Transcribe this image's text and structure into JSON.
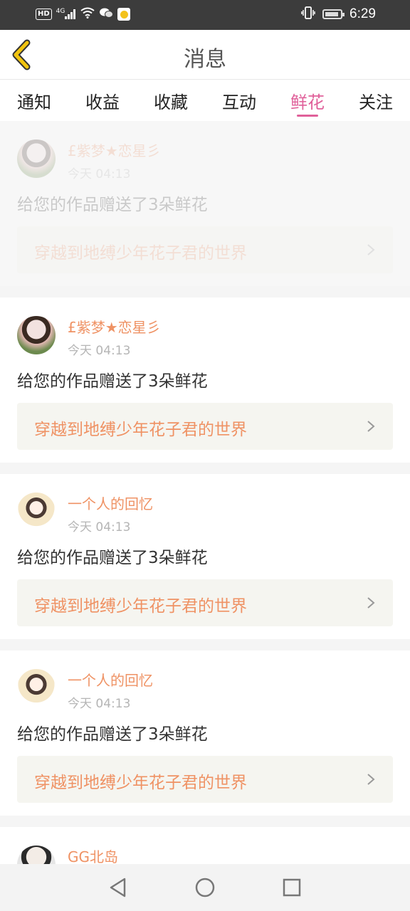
{
  "status_bar": {
    "hd": "HD",
    "network": "4G",
    "time": "6:29",
    "icons": [
      "hd-badge",
      "signal-icon",
      "wifi-icon",
      "wechat-icon",
      "app-icon",
      "vibrate-icon",
      "battery-icon"
    ]
  },
  "header": {
    "title": "消息",
    "back_icon": "chevron-left-icon"
  },
  "tabs": [
    {
      "label": "通知",
      "active": false
    },
    {
      "label": "收益",
      "active": false
    },
    {
      "label": "收藏",
      "active": false
    },
    {
      "label": "互动",
      "active": false
    },
    {
      "label": "鲜花",
      "active": true
    },
    {
      "label": "关注",
      "active": false
    }
  ],
  "messages": [
    {
      "user": "£紫梦★恋星彡",
      "time": "今天 04:13",
      "text": "给您的作品赠送了3朵鲜花",
      "work": "穿越到地缚少年花子君的世界"
    },
    {
      "user": "£紫梦★恋星彡",
      "time": "今天 04:13",
      "text": "给您的作品赠送了3朵鲜花",
      "work": "穿越到地缚少年花子君的世界"
    },
    {
      "user": "一个人的回忆",
      "time": "今天 04:13",
      "text": "给您的作品赠送了3朵鲜花",
      "work": "穿越到地缚少年花子君的世界"
    },
    {
      "user": "一个人的回忆",
      "time": "今天 04:13",
      "text": "给您的作品赠送了3朵鲜花",
      "work": "穿越到地缚少年花子君的世界"
    },
    {
      "user": "GG北岛"
    }
  ],
  "colors": {
    "accent": "#e0609a",
    "username": "#ef9264",
    "work_bg": "#f5f5f0",
    "back_icon": "#f1c40f"
  },
  "nav": [
    "back-triangle-icon",
    "home-circle-icon",
    "recent-square-icon"
  ]
}
